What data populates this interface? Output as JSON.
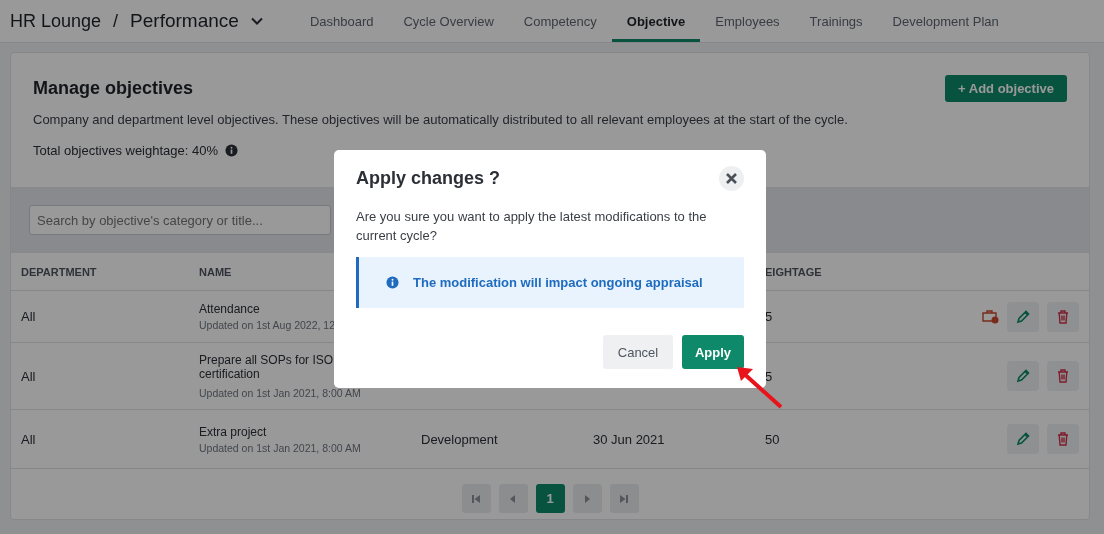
{
  "header": {
    "brand": "HR Lounge",
    "separator": "/",
    "module": "Performance"
  },
  "tabs": [
    {
      "label": "Dashboard",
      "selected": false
    },
    {
      "label": "Cycle Overview",
      "selected": false
    },
    {
      "label": "Competency",
      "selected": false
    },
    {
      "label": "Objective",
      "selected": true
    },
    {
      "label": "Employees",
      "selected": false
    },
    {
      "label": "Trainings",
      "selected": false
    },
    {
      "label": "Development Plan",
      "selected": false
    }
  ],
  "page": {
    "title": "Manage objectives",
    "description": "Company and department level objectives. These objectives will be automatically distributed to all relevant employees at the start of the cycle.",
    "weightage": "Total objectives weightage: 40%",
    "add_button": "+ Add objective"
  },
  "search": {
    "placeholder": "Search by objective's category or title..."
  },
  "table": {
    "columns": [
      {
        "label": "DEPARTMENT"
      },
      {
        "label": "NAME"
      },
      {
        "label": "EIGHTAGE"
      }
    ],
    "rows": [
      {
        "department": "All",
        "name": "Attendance",
        "updated": "Updated on 1st Aug 2022, 12",
        "weightage": "5",
        "alert": true
      },
      {
        "department": "All",
        "name": "Prepare all SOPs for ISO",
        "name_2": "certification",
        "updated": "Updated on 1st Jan 2021, 8:00 AM",
        "weightage": "5",
        "alert": false
      },
      {
        "department": "All",
        "name": "Extra project",
        "updated": "Updated on 1st Jan 2021, 8:00 AM",
        "category": "Development",
        "date": "30 Jun 2021",
        "weightage": "50",
        "alert": false
      }
    ]
  },
  "pagination": {
    "pages": [
      {
        "label": "1",
        "selected": true
      }
    ]
  },
  "dialog": {
    "title": "Apply changes ?",
    "message": "Are you sure you want to apply the latest modifications to the current cycle?",
    "notice": "The modification will impact ongoing appraisal",
    "cancel": "Cancel",
    "apply": "Apply"
  }
}
